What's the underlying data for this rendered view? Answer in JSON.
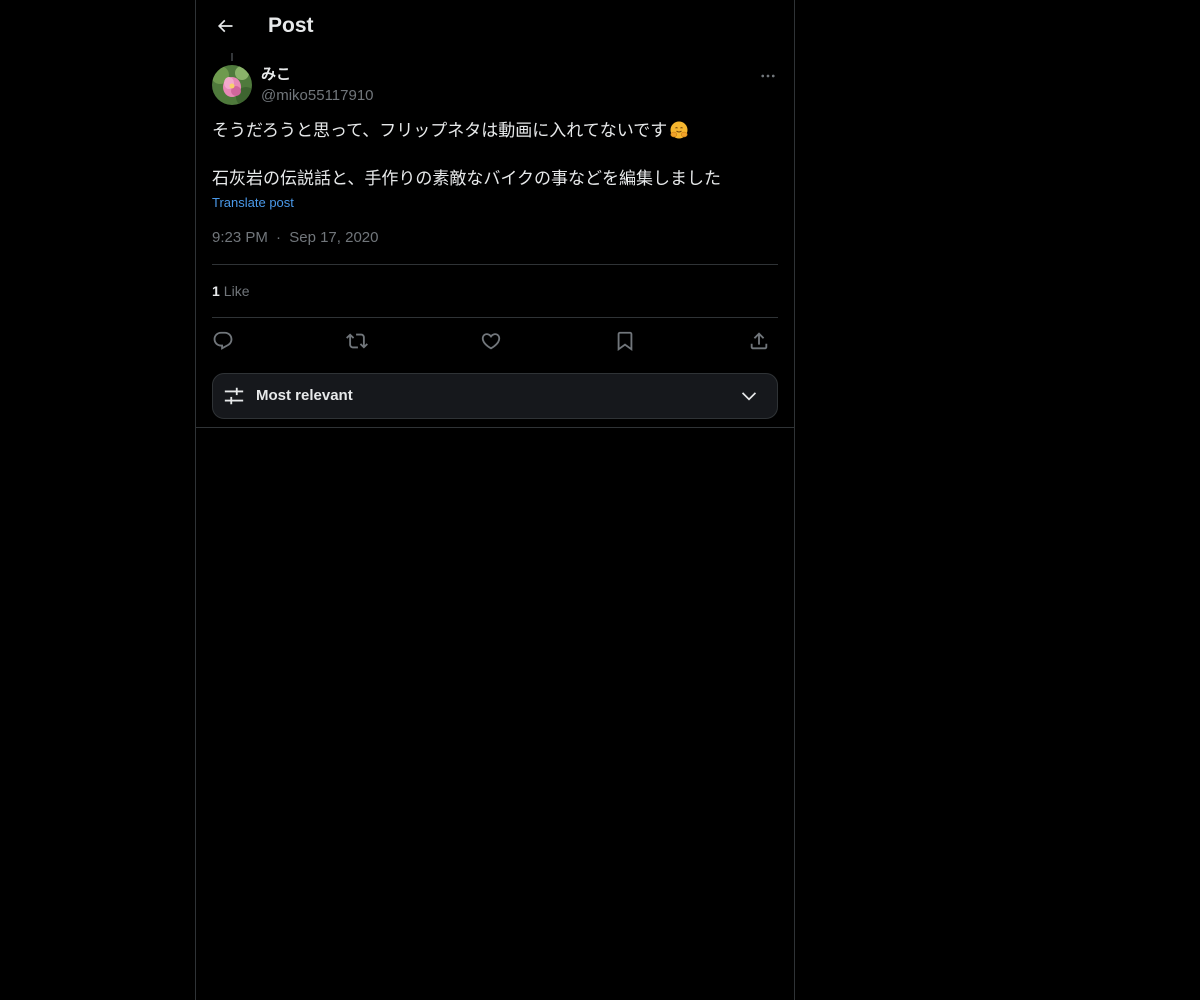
{
  "header": {
    "back_icon": "arrow-left-icon",
    "title": "Post"
  },
  "post": {
    "author": {
      "name": "みこ",
      "handle": "@miko55117910",
      "avatar": "pink-flower-avatar"
    },
    "more_icon": "more-horizontal-icon",
    "text_line1": "そうだろうと思って、フリップネタは動画に入れてないです",
    "text_emoji": "hugging-face-emoji",
    "text_line2": "石灰岩の伝説話と、手作りの素敵なバイクの事などを編集しました",
    "translate_label": "Translate post",
    "time": "9:23 PM",
    "separator": "·",
    "date": "Sep 17, 2020",
    "likes_count": "1",
    "likes_label": "Like"
  },
  "actions": [
    {
      "name": "reply",
      "icon": "reply-icon"
    },
    {
      "name": "repost",
      "icon": "repost-icon"
    },
    {
      "name": "like",
      "icon": "heart-icon"
    },
    {
      "name": "bookmark",
      "icon": "bookmark-icon"
    },
    {
      "name": "share",
      "icon": "share-icon"
    }
  ],
  "sort": {
    "icon": "sliders-icon",
    "label": "Most relevant",
    "chevron": "chevron-down-icon"
  },
  "colors": {
    "background": "#000000",
    "text": "#e7e9ea",
    "muted": "#71767b",
    "link": "#4a99e9",
    "border": "#2f3336"
  }
}
